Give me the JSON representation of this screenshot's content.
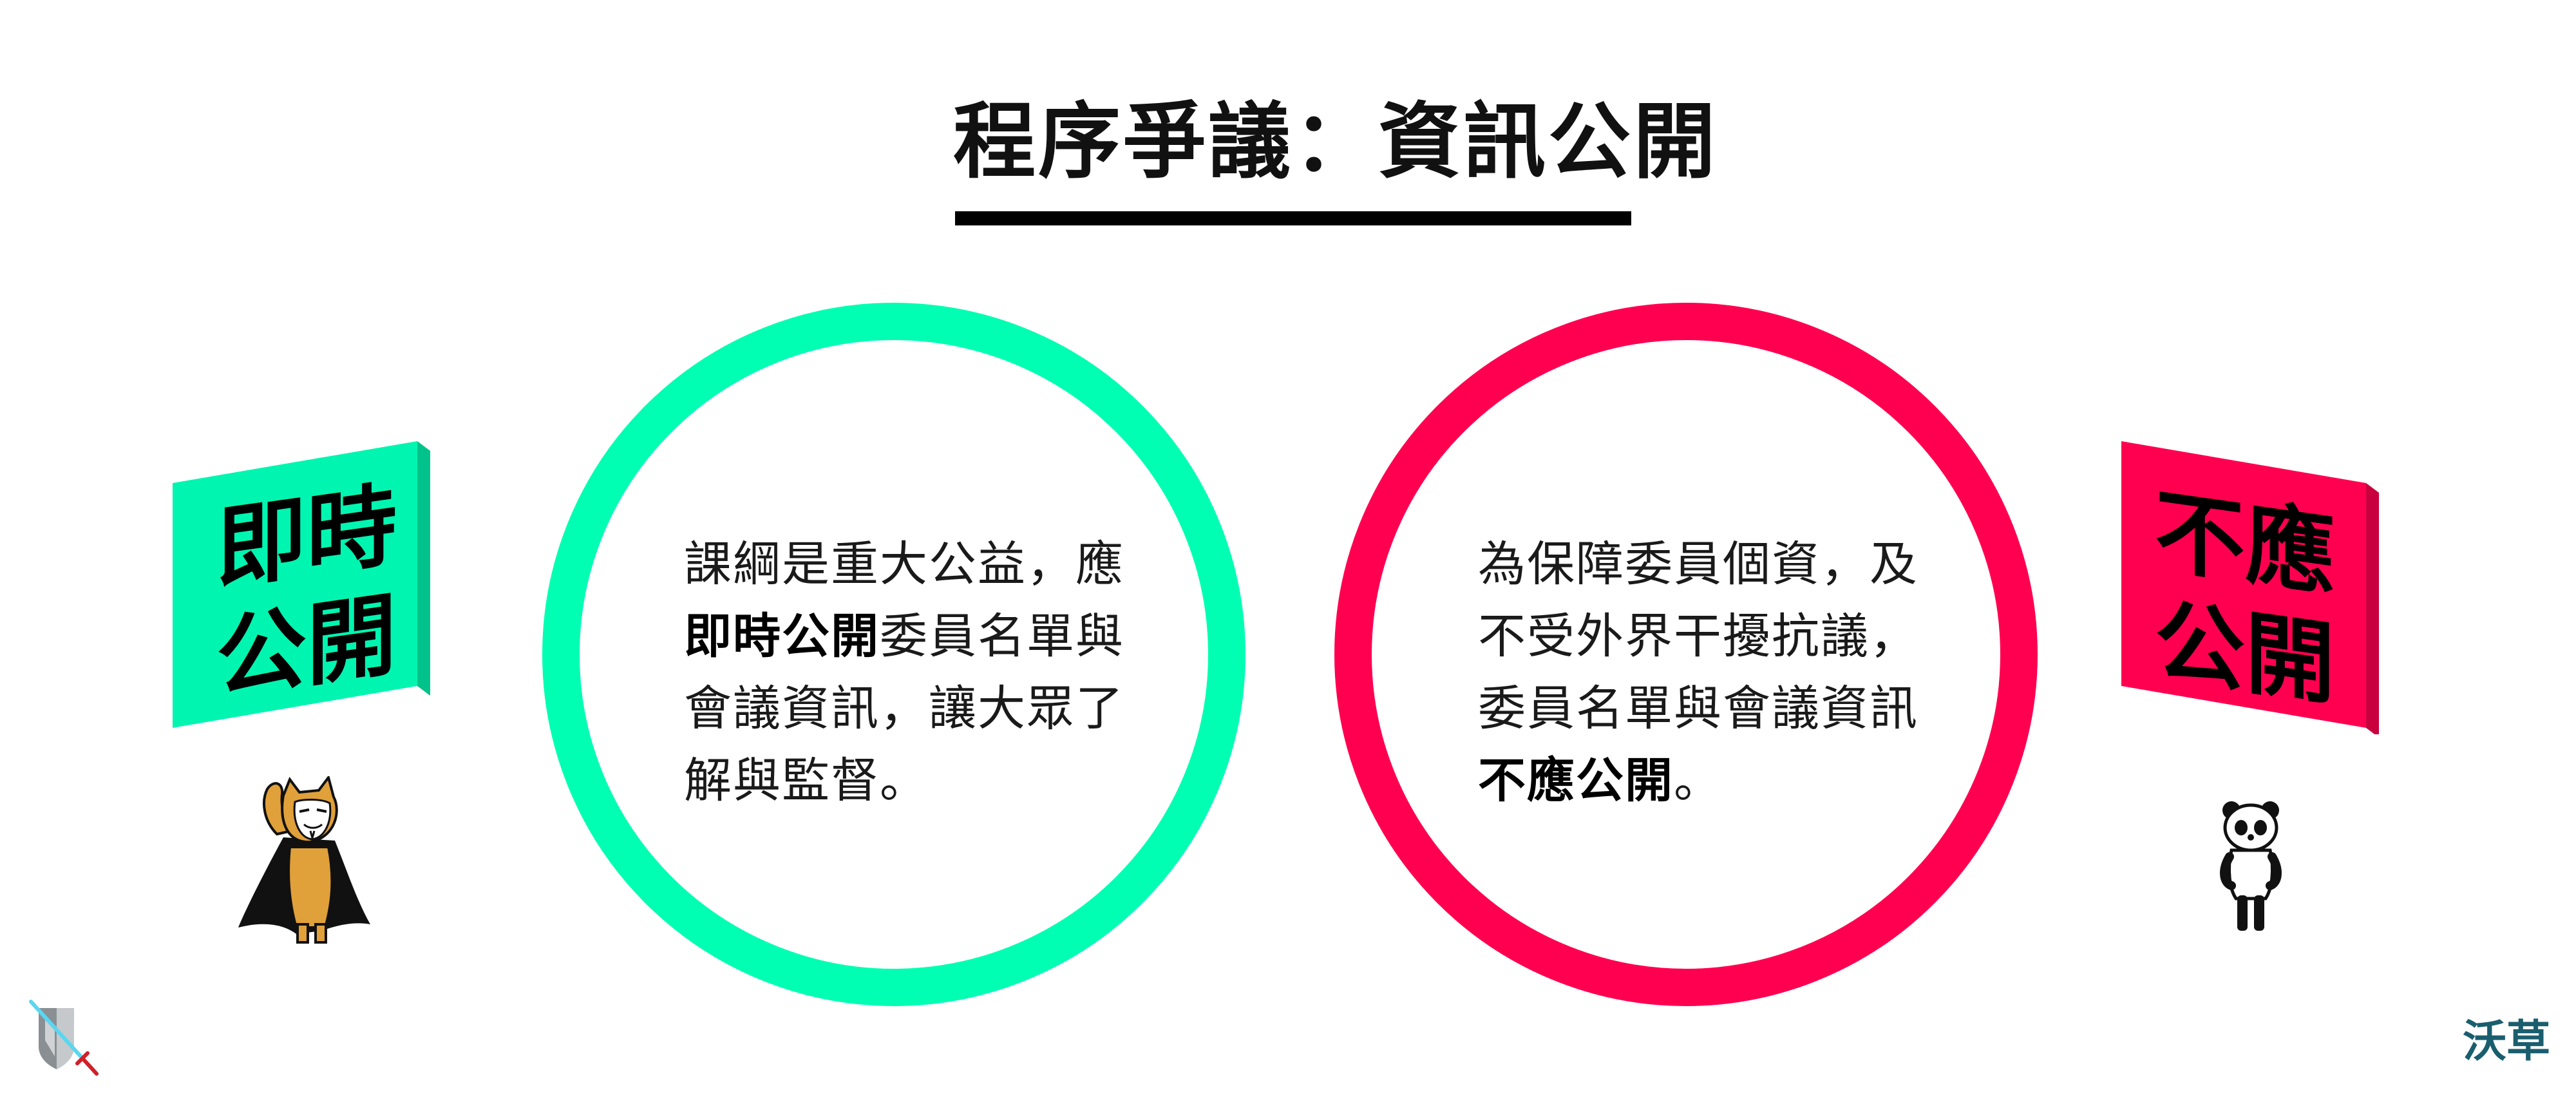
{
  "title": "程序爭議：資訊公開",
  "left_sign": {
    "lines": [
      "即時",
      "公開"
    ],
    "color": "#00f5b0",
    "top_color": "#55ffcc",
    "side_color": "#00c28a"
  },
  "right_sign": {
    "lines": [
      "不應",
      "公開"
    ],
    "color": "#ff0050",
    "top_color": "#ff5590",
    "side_color": "#c8003e"
  },
  "left_circle": {
    "color": "#00ffb2",
    "lines": [
      {
        "bold": "",
        "text": "課綱是重大公益，應"
      },
      {
        "bold": "即時公開",
        "text": "委員名單與"
      },
      {
        "bold": "",
        "text": "會議資訊，讓大眾了"
      },
      {
        "bold": "",
        "text": "解與監督。"
      }
    ]
  },
  "right_circle": {
    "color": "#ff0050",
    "lines": [
      {
        "bold": "",
        "text": "為保障委員個資，及"
      },
      {
        "bold": "",
        "text": "不受外界干擾抗議，"
      },
      {
        "bold": "",
        "text": "委員名單與會議資訊"
      },
      {
        "bold": "不應公開",
        "text": "。"
      }
    ]
  },
  "left_character": {
    "icon": "masked-cat-icon"
  },
  "right_character": {
    "icon": "panda-icon"
  },
  "logo_left": {
    "icon": "shield-sword-logo-icon"
  },
  "logo_right": {
    "text": "沃草",
    "color": "#1a5e6e"
  }
}
